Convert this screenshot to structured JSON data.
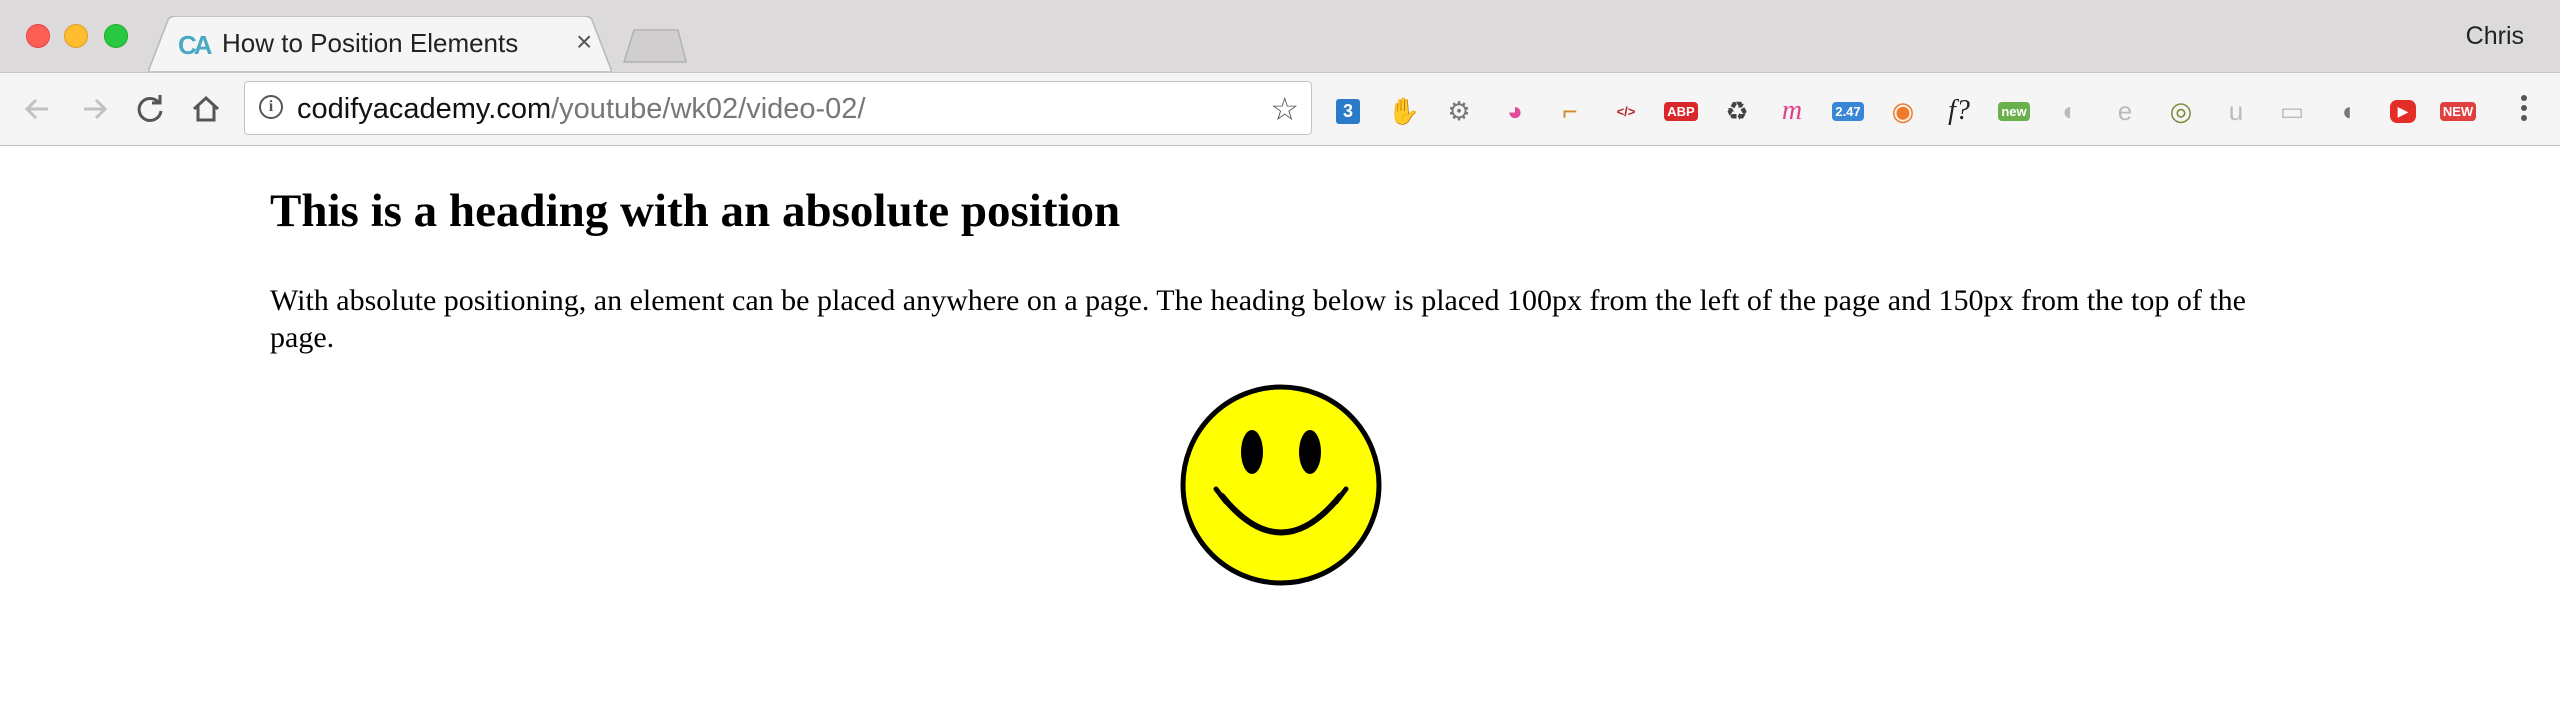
{
  "window": {
    "profile_name": "Chris"
  },
  "tab": {
    "favicon_text": "CA",
    "title": "How to Position Elements",
    "close_glyph": "×"
  },
  "toolbar": {
    "url_host": "codifyacademy.com",
    "url_path": "/youtube/wk02/video-02/",
    "info_glyph": "i",
    "star_glyph": "☆",
    "extensions": [
      {
        "name": "css3-icon",
        "label": "3",
        "color": "#2b7bcb"
      },
      {
        "name": "ublock-icon",
        "label": "✋",
        "color": "#e23a2f"
      },
      {
        "name": "gear-ext-icon",
        "label": "⚙",
        "color": "#777777"
      },
      {
        "name": "color-wheel-icon",
        "label": "◕",
        "color": "#e24b9a"
      },
      {
        "name": "ruler-icon",
        "label": "⌐",
        "color": "#d08a2a"
      },
      {
        "name": "code-icon",
        "label": "</>",
        "color": "#b3262a"
      },
      {
        "name": "adblock-plus-icon",
        "label": "ABP",
        "color": "#d9272b"
      },
      {
        "name": "recycle-icon",
        "label": "♻",
        "color": "#444444"
      },
      {
        "name": "m-script-icon",
        "label": "m",
        "color": "#e2408a"
      },
      {
        "name": "speed-gauge-icon",
        "label": "2.47",
        "color": "#3a86d6"
      },
      {
        "name": "compass-icon",
        "label": "◉",
        "color": "#f07a2a"
      },
      {
        "name": "font-icon",
        "label": "f?",
        "color": "#222222"
      },
      {
        "name": "screenshot-new-icon",
        "label": "new",
        "color": "#6ab04c"
      },
      {
        "name": "swirl-icon",
        "label": "◐",
        "color": "#bbbbbb"
      },
      {
        "name": "e-icon",
        "label": "e",
        "color": "#bbbbbb"
      },
      {
        "name": "circle-ext-icon",
        "label": "◎",
        "color": "#7a8d3a"
      },
      {
        "name": "u-icon",
        "label": "u",
        "color": "#bbbbbb"
      },
      {
        "name": "chat-icon",
        "label": "▭",
        "color": "#bbbbbb"
      },
      {
        "name": "audio-icon",
        "label": "◖",
        "color": "#777777"
      },
      {
        "name": "youtube-icon",
        "label": "▶",
        "color": "#e52d27"
      },
      {
        "name": "new-badge-icon",
        "label": "NEW",
        "color": "#e04040"
      }
    ]
  },
  "page": {
    "heading": "This is a heading with an absolute position",
    "paragraph": "With absolute positioning, an element can be placed anywhere on a page. The heading below is placed 100px from the left of the page and 150px from the top of the page.",
    "smiley_color": "#ffff00"
  }
}
